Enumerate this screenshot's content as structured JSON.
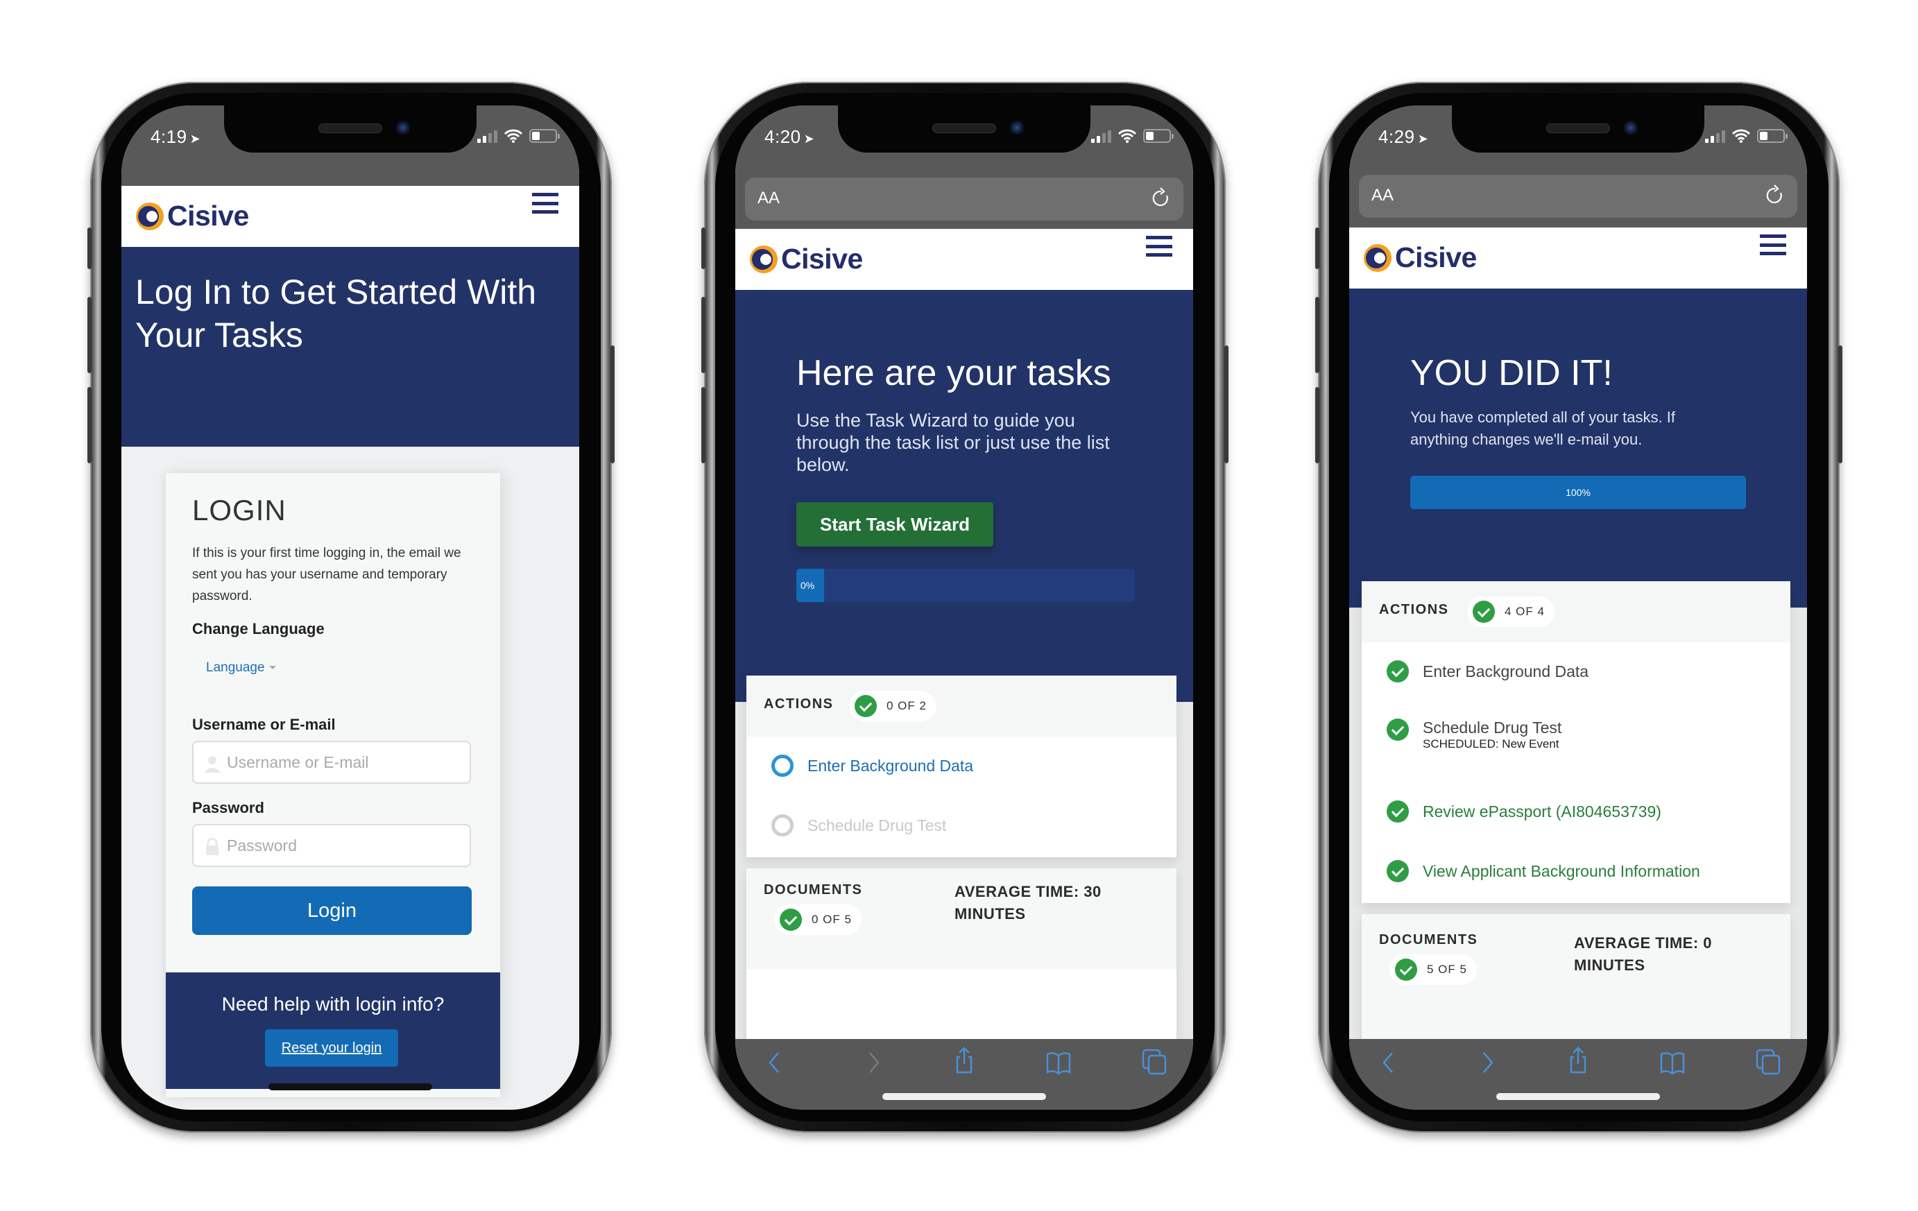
{
  "brand": {
    "name": "Cisive",
    "accent_orange": "#f4a020",
    "navy": "#232d6b",
    "hero_bg": "#223367",
    "link_blue": "#136bb5",
    "success_green": "#2e9d44"
  },
  "phones": [
    {
      "status": {
        "time": "4:19",
        "location_icon": "location-arrow-icon",
        "signal_icon": "cellular-signal-icon",
        "wifi_icon": "wifi-icon",
        "battery_icon": "battery-icon"
      },
      "header": {
        "logo_text": "Cisive",
        "menu_icon": "hamburger-menu-icon"
      },
      "hero": {
        "title": "Log In to Get Started With Your Tasks"
      },
      "login": {
        "title": "LOGIN",
        "intro": "If this is your first time logging in, the email we sent you has your username and temporary password.",
        "change_language_label": "Change Language",
        "language_link": "Language",
        "username_label": "Username or E-mail",
        "username_placeholder": "Username or E-mail",
        "username_value": "",
        "password_label": "Password",
        "password_placeholder": "Password",
        "password_value": "",
        "login_button": "Login"
      },
      "help": {
        "question": "Need help with login info?",
        "reset_link": "Reset your login"
      }
    },
    {
      "status": {
        "time": "4:20",
        "location_icon": "location-arrow-icon",
        "signal_icon": "cellular-signal-icon",
        "wifi_icon": "wifi-icon",
        "battery_icon": "battery-icon"
      },
      "browser": {
        "text_size_label": "AA",
        "reload_icon": "reload-icon"
      },
      "header": {
        "logo_text": "Cisive",
        "menu_icon": "hamburger-menu-icon"
      },
      "hero": {
        "title": "Here are your tasks",
        "subtitle": "Use the Task Wizard to guide you through the task list or just use the list below.",
        "wizard_button": "Start Task Wizard",
        "progress_percent": 0,
        "progress_label": "0%"
      },
      "actions": {
        "label": "ACTIONS",
        "count": "0 OF 2",
        "items": [
          {
            "label": "Enter Background Data",
            "state": "active"
          },
          {
            "label": "Schedule Drug Test",
            "state": "disabled"
          }
        ]
      },
      "documents": {
        "label": "DOCUMENTS",
        "count": "0 OF 5",
        "average_time_line1": "AVERAGE TIME: 30",
        "average_time_line2": "MINUTES"
      },
      "toolbar": {
        "back": "back-chevron-icon",
        "forward": "forward-chevron-icon",
        "share": "share-icon",
        "bookmarks": "bookmarks-icon",
        "tabs": "tabs-icon"
      }
    },
    {
      "status": {
        "time": "4:29",
        "location_icon": "location-arrow-icon",
        "signal_icon": "cellular-signal-icon",
        "wifi_icon": "wifi-icon",
        "battery_icon": "battery-icon"
      },
      "browser": {
        "text_size_label": "AA",
        "reload_icon": "reload-icon"
      },
      "header": {
        "logo_text": "Cisive",
        "menu_icon": "hamburger-menu-icon"
      },
      "hero": {
        "title": "YOU DID IT!",
        "subtitle": "You have completed all of your tasks. If anything changes we'll e-mail you.",
        "progress_percent": 100,
        "progress_label": "100%"
      },
      "actions": {
        "label": "ACTIONS",
        "count": "4 OF 4",
        "items": [
          {
            "label": "Enter Background Data",
            "state": "done",
            "sub": ""
          },
          {
            "label": "Schedule Drug Test",
            "state": "done",
            "sub": "SCHEDULED: New Event"
          },
          {
            "label": "Review ePassport (AI804653739)",
            "state": "done-link",
            "sub": ""
          },
          {
            "label": "View Applicant Background Information",
            "state": "done-link",
            "sub": ""
          }
        ]
      },
      "documents": {
        "label": "DOCUMENTS",
        "count": "5 OF 5",
        "average_time_line1": "AVERAGE TIME: 0",
        "average_time_line2": "MINUTES"
      },
      "toolbar": {
        "back": "back-chevron-icon",
        "forward": "forward-chevron-icon",
        "share": "share-icon",
        "bookmarks": "bookmarks-icon",
        "tabs": "tabs-icon"
      }
    }
  ]
}
